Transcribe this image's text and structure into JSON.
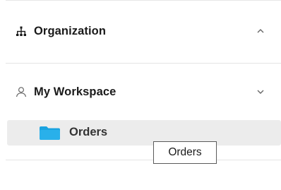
{
  "sections": [
    {
      "label": "Organization",
      "icon": "sitemap-icon",
      "chevron": "chevron-up-icon",
      "expanded": true
    },
    {
      "label": "My Workspace",
      "icon": "user-icon",
      "chevron": "chevron-down-icon",
      "expanded": true,
      "items": [
        {
          "label": "Orders",
          "icon": "folder-icon",
          "hovered": true
        }
      ]
    }
  ],
  "tooltip": {
    "text": "Orders"
  },
  "colors": {
    "folder": "#1aa3e0",
    "hover_background": "#ececec",
    "divider": "#e4e4e4",
    "tooltip_border": "#5a5a5a",
    "icon_gray": "#666666"
  }
}
